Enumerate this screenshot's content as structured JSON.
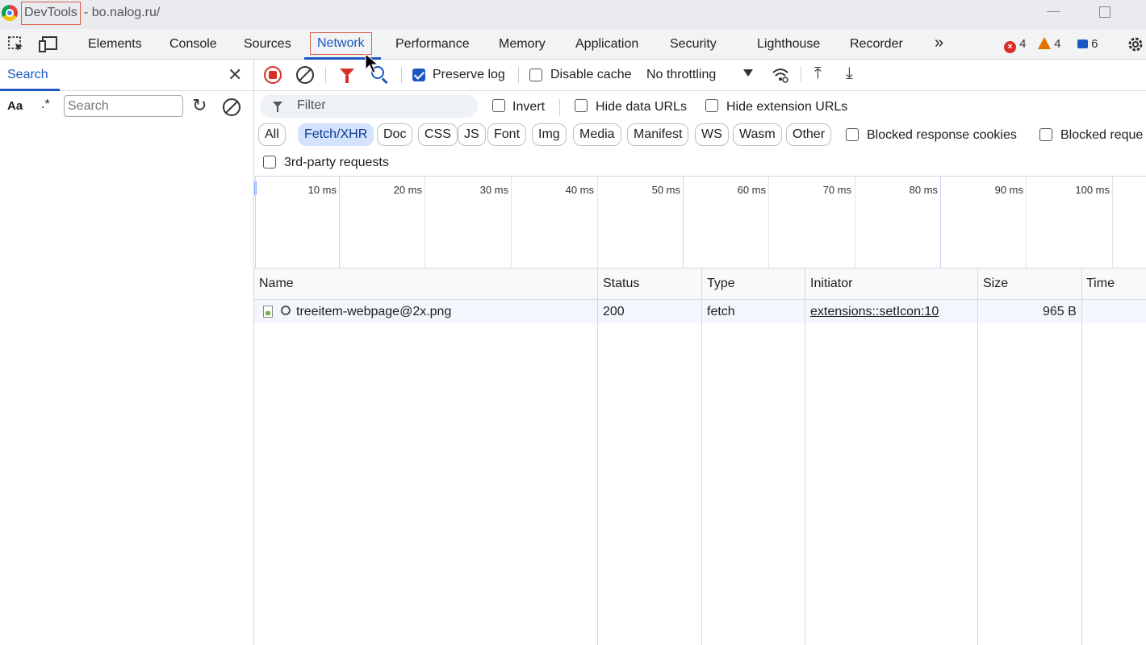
{
  "window": {
    "app_name": "DevTools",
    "page": "- bo.nalog.ru/"
  },
  "tabs": [
    {
      "label": "Elements"
    },
    {
      "label": "Console"
    },
    {
      "label": "Sources"
    },
    {
      "label": "Network"
    },
    {
      "label": "Performance"
    },
    {
      "label": "Memory"
    },
    {
      "label": "Application"
    },
    {
      "label": "Security"
    },
    {
      "label": "Lighthouse"
    },
    {
      "label": "Recorder"
    }
  ],
  "more_tabs": "»",
  "counters": {
    "errors": "4",
    "warnings": "4",
    "messages": "6"
  },
  "search_panel": {
    "title": "Search",
    "case_label": "Aa",
    "regex_label": ".*",
    "input_placeholder": "Search"
  },
  "toolbar": {
    "preserve_log": {
      "label": "Preserve log",
      "checked": true
    },
    "disable_cache": {
      "label": "Disable cache",
      "checked": false
    },
    "throttling": "No throttling"
  },
  "filter": {
    "placeholder": "Filter",
    "invert": "Invert",
    "hide_data_urls": "Hide data URLs",
    "hide_extension_urls": "Hide extension URLs",
    "types": [
      "All",
      "Fetch/XHR",
      "Doc",
      "CSS",
      "JS",
      "Font",
      "Img",
      "Media",
      "Manifest",
      "WS",
      "Wasm",
      "Other"
    ],
    "active_type": "Fetch/XHR",
    "blocked_response_cookies": "Blocked response cookies",
    "blocked_requests": "Blocked reque",
    "third_party": "3rd-party requests"
  },
  "timeline": {
    "ticks": [
      "10 ms",
      "20 ms",
      "30 ms",
      "40 ms",
      "50 ms",
      "60 ms",
      "70 ms",
      "80 ms",
      "90 ms",
      "100 ms"
    ]
  },
  "table": {
    "columns": [
      "Name",
      "Status",
      "Type",
      "Initiator",
      "Size",
      "Time"
    ],
    "rows": [
      {
        "name": "treeitem-webpage@2x.png",
        "status": "200",
        "type": "fetch",
        "initiator": "extensions::setIcon:10",
        "size": "965 B"
      }
    ]
  },
  "colors": {
    "accent": "#1a57c2",
    "error": "#d93025",
    "warning": "#e37400",
    "highlight_box": "#e05a47"
  }
}
